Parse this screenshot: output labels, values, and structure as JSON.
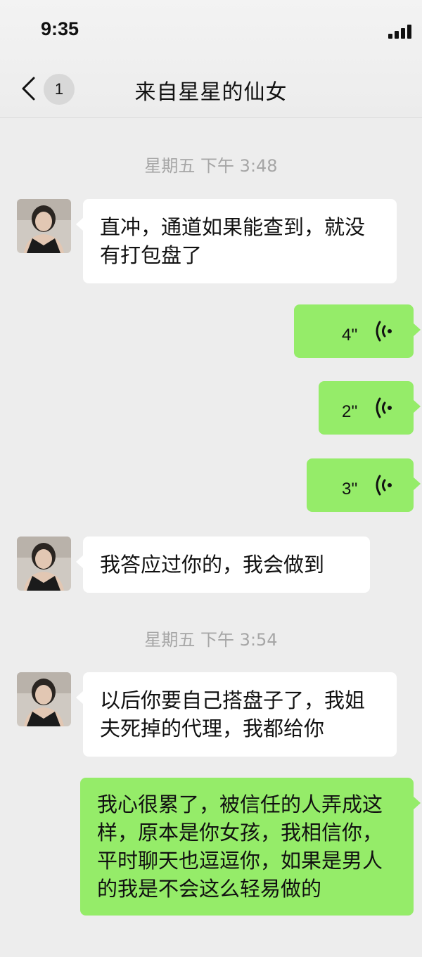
{
  "status_bar": {
    "time": "9:35"
  },
  "header": {
    "unread_count": "1",
    "title": "来自星星的仙女"
  },
  "timestamps": [
    "星期五 下午 3:48",
    "星期五 下午 3:54"
  ],
  "messages": [
    {
      "side": "in",
      "type": "text",
      "text": "直冲，通道如果能查到，就没有打包盘了"
    },
    {
      "side": "out",
      "type": "voice",
      "duration": "4''"
    },
    {
      "side": "out",
      "type": "voice",
      "duration": "2''"
    },
    {
      "side": "out",
      "type": "voice",
      "duration": "3''"
    },
    {
      "side": "in",
      "type": "text",
      "text": "我答应过你的，我会做到"
    },
    {
      "side": "in",
      "type": "text",
      "text": "以后你要自己搭盘子了，我姐夫死掉的代理，我都给你"
    },
    {
      "side": "out",
      "type": "text",
      "text": "我心很累了，被信任的人弄成这样，原本是你女孩，我相信你，平时聊天也逗逗你，如果是男人的我是不会这么轻易做的"
    }
  ],
  "colors": {
    "background": "#ededed",
    "outgoing_bubble": "#95ec69",
    "incoming_bubble": "#ffffff",
    "timestamp": "#a6a6a6"
  },
  "icons": [
    "signal-icon",
    "back-chevron-icon",
    "voice-wave-icon",
    "contact-avatar"
  ]
}
